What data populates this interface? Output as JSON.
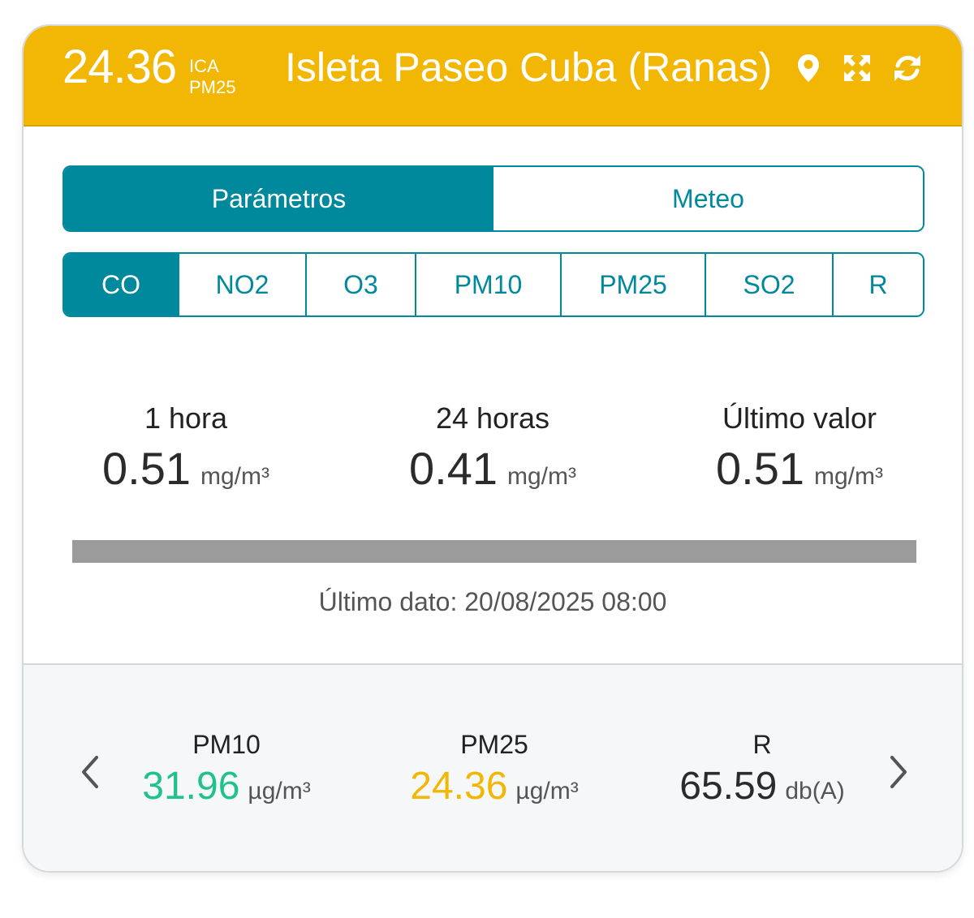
{
  "header": {
    "ica_value": "24.36",
    "ica_label": "ICA",
    "ica_pollutant": "PM25",
    "station_name": "Isleta Paseo Cuba (Ranas)",
    "color": "#f2b705",
    "icons": [
      "map-marker-icon",
      "expand-icon",
      "refresh-icon"
    ]
  },
  "tabs": [
    {
      "label": "Parámetros",
      "active": true
    },
    {
      "label": "Meteo",
      "active": false
    }
  ],
  "parameters": [
    {
      "label": "CO",
      "active": true
    },
    {
      "label": "NO2",
      "active": false
    },
    {
      "label": "O3",
      "active": false
    },
    {
      "label": "PM10",
      "active": false
    },
    {
      "label": "PM25",
      "active": false
    },
    {
      "label": "SO2",
      "active": false
    },
    {
      "label": "R",
      "active": false
    }
  ],
  "stats": [
    {
      "label": "1 hora",
      "value": "0.51",
      "unit": "mg/m³"
    },
    {
      "label": "24 horas",
      "value": "0.41",
      "unit": "mg/m³"
    },
    {
      "label": "Último valor",
      "value": "0.51",
      "unit": "mg/m³"
    }
  ],
  "level_bar_color": "#9b9b9b",
  "last_data": "Último dato: 20/08/2025 08:00",
  "summary": [
    {
      "label": "PM10",
      "value": "31.96",
      "unit": "µg/m³",
      "color": "#1fc28a"
    },
    {
      "label": "PM25",
      "value": "24.36",
      "unit": "µg/m³",
      "color": "#f2b705"
    },
    {
      "label": "R",
      "value": "65.59",
      "unit": "db(A)",
      "color": "#2b2b2b"
    }
  ],
  "accent_color": "#00889c"
}
